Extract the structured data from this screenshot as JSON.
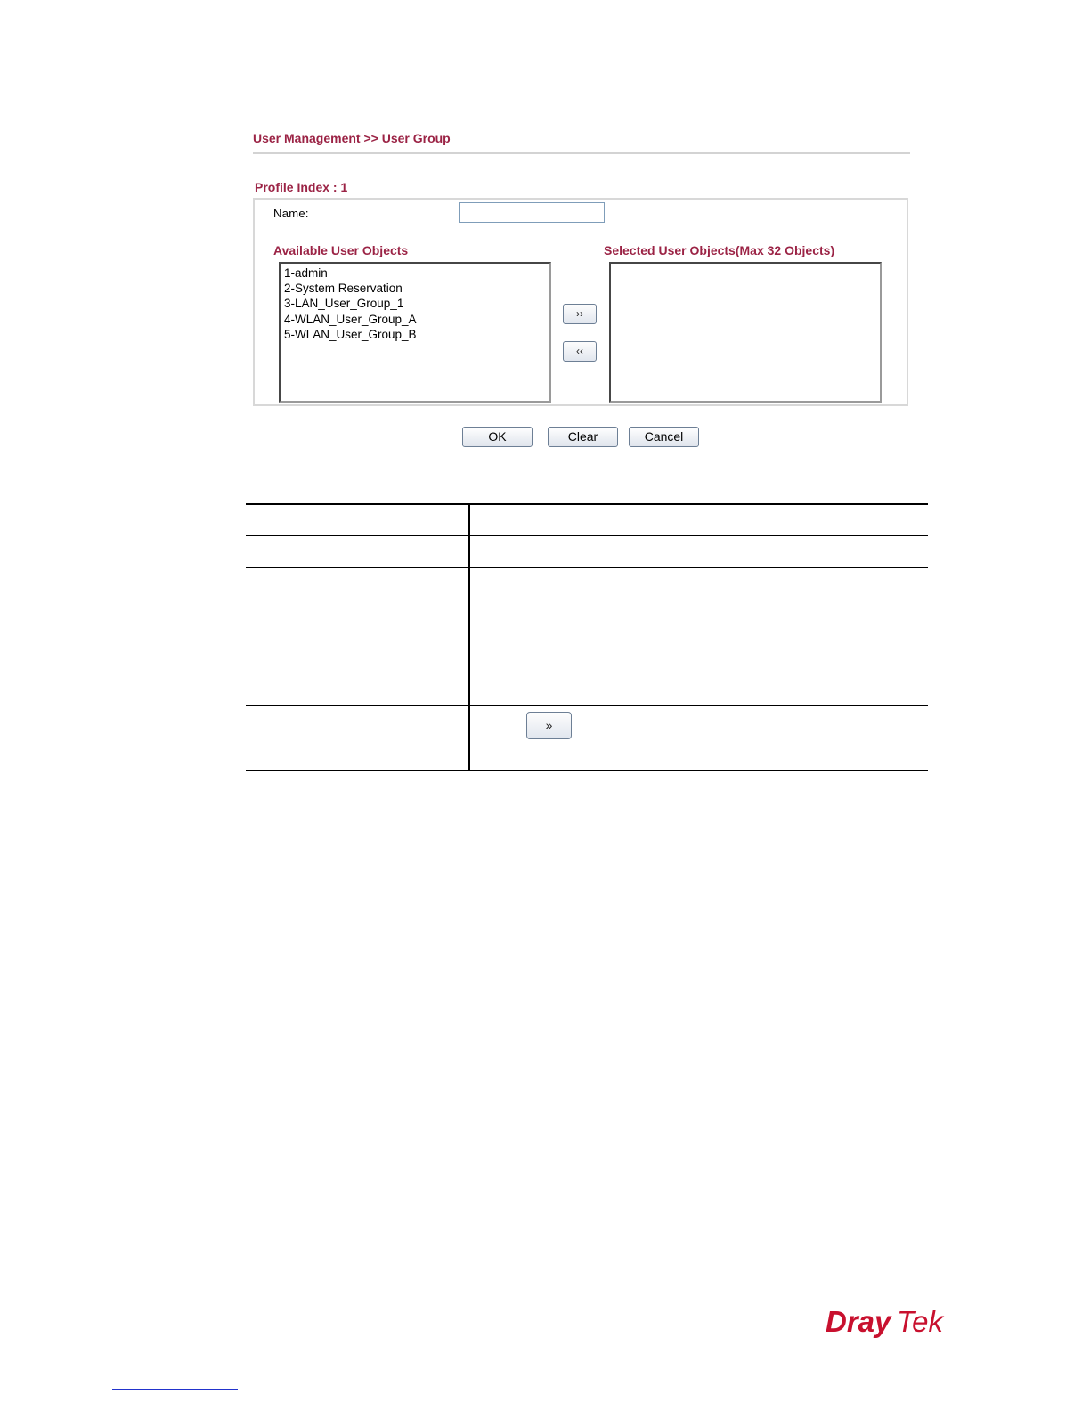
{
  "breadcrumb": "User Management >> User Group",
  "profile_index": "Profile Index : 1",
  "form": {
    "name_label": "Name:",
    "name_value": "",
    "available_label": "Available User Objects",
    "selected_label": "Selected User Objects(Max 32 Objects)",
    "available_items": [
      "1-admin",
      "2-System Reservation",
      "3-LAN_User_Group_1",
      "4-WLAN_User_Group_A",
      "5-WLAN_User_Group_B"
    ],
    "selected_items": [],
    "add_button": "››",
    "remove_button": "‹‹"
  },
  "buttons": {
    "ok": "OK",
    "clear": "Clear",
    "cancel": "Cancel"
  },
  "description_table": {
    "add_button_label": "»"
  },
  "brand": {
    "logo_text_part1": "Dray",
    "logo_text_part2": "Tek",
    "color": "#c8102e"
  }
}
